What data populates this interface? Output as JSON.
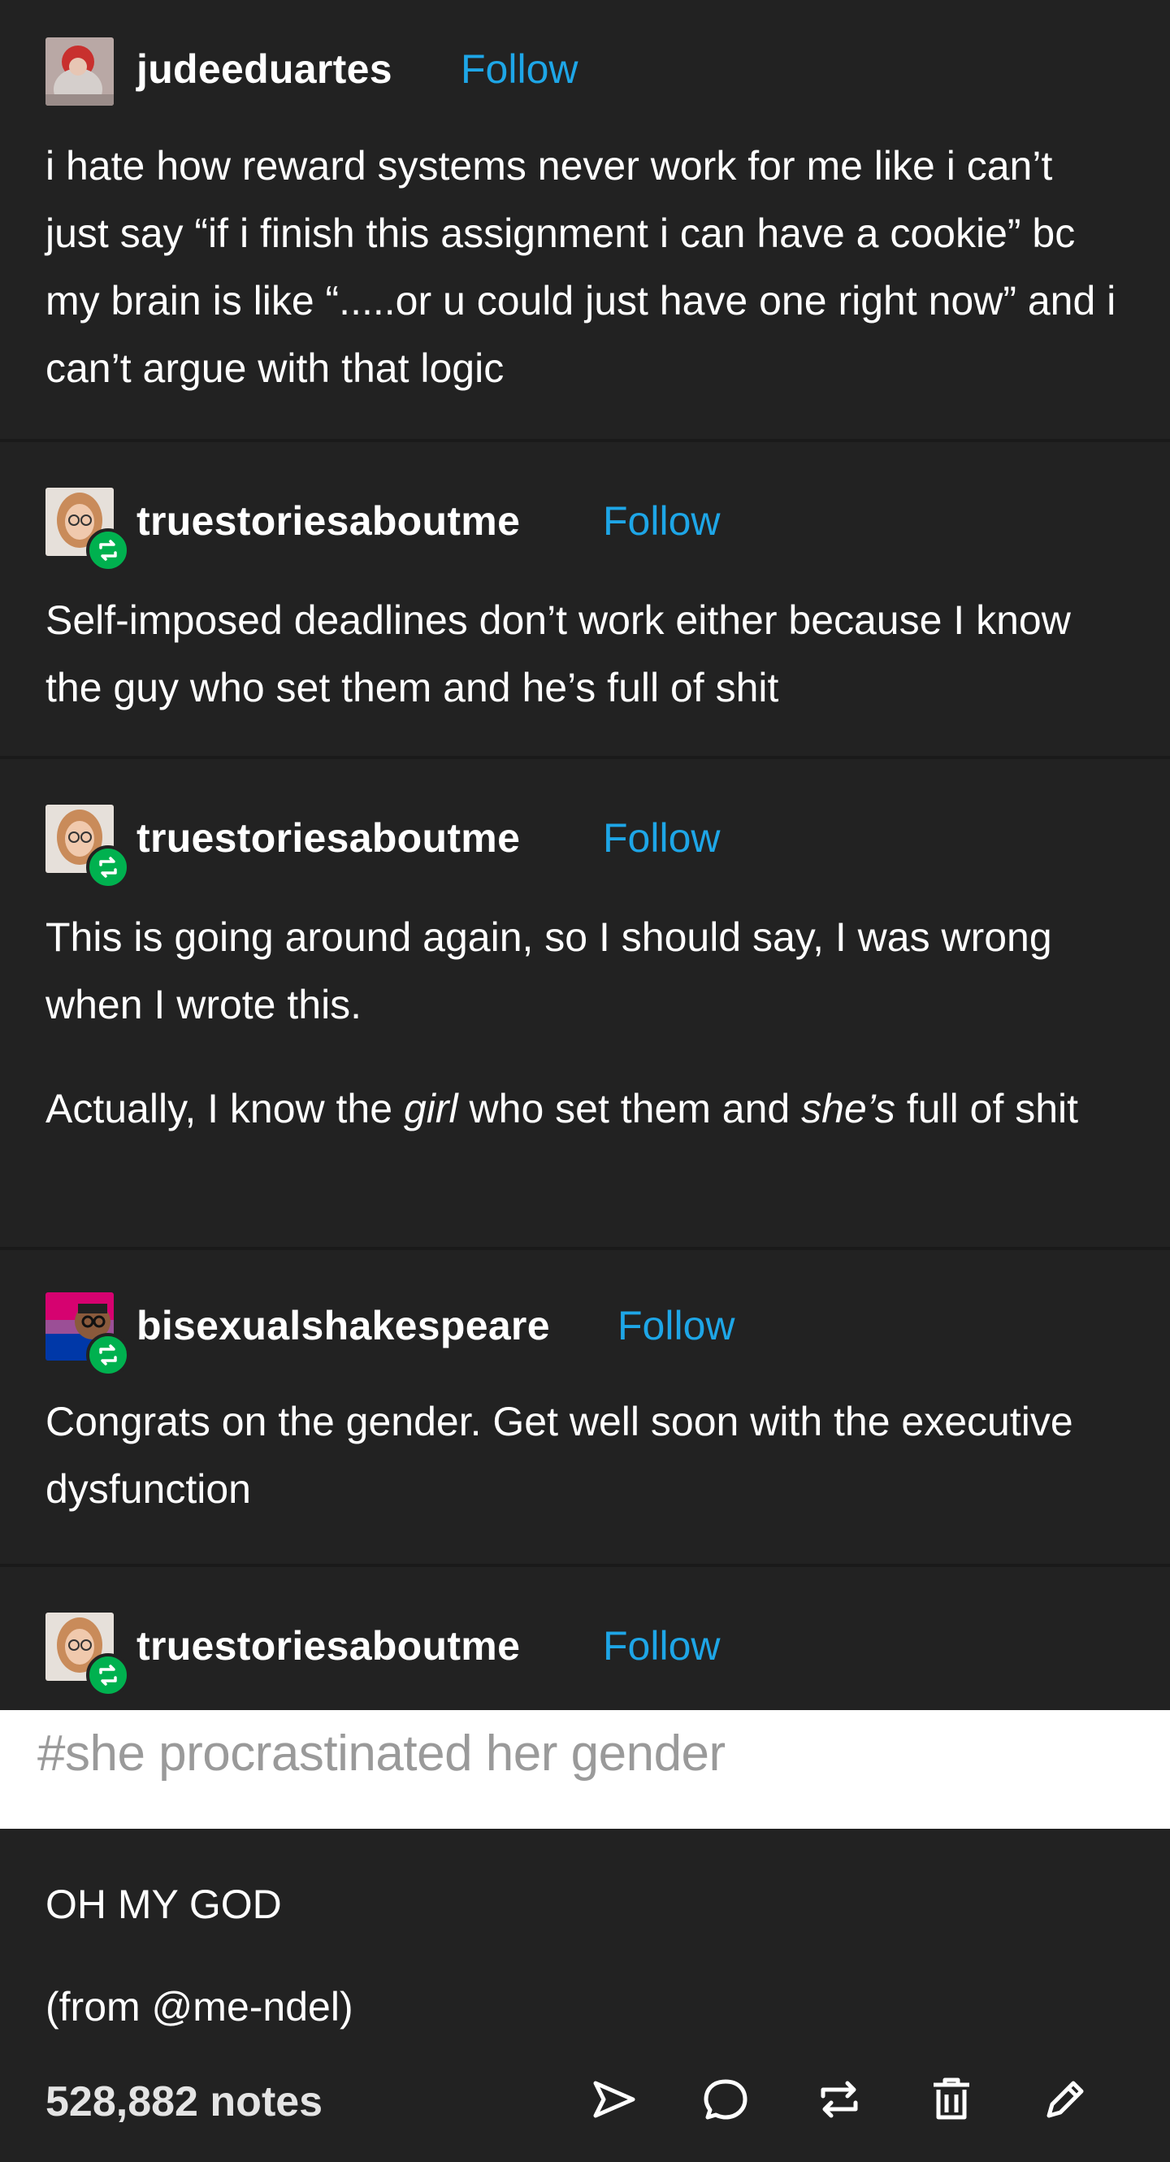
{
  "posts": [
    {
      "username": "judeeduartes",
      "follow_label": "Follow",
      "body": [
        "i hate how reward systems never work for me like i can’t just say “if i finish this assignment i can have a cookie” bc my brain is like “.....or u could just have one right now” and i can’t argue with that logic"
      ]
    },
    {
      "username": "truestoriesaboutme",
      "follow_label": "Follow",
      "body": [
        "Self-imposed deadlines don’t work either because I know the guy who set them and he’s full of shit"
      ]
    },
    {
      "username": "truestoriesaboutme",
      "follow_label": "Follow",
      "body": [
        "This is going around again, so I should say, I was wrong when I wrote this."
      ],
      "body2": {
        "part1": "Actually, I know the ",
        "girl": "girl",
        "part2": " who set them and ",
        "shes": "she’s",
        "part3": " full of shit"
      }
    },
    {
      "username": "bisexualshakespeare",
      "follow_label": "Follow",
      "body": [
        "Congrats on the gender. Get well soon with the executive dysfunction"
      ]
    },
    {
      "username": "truestoriesaboutme",
      "follow_label": "Follow"
    }
  ],
  "tag": "#she procrastinated her gender",
  "footer": {
    "line1": "OH MY GOD",
    "line2": "(from @me-ndel)",
    "notes": "528,882 notes"
  },
  "actions": [
    "send-icon",
    "comment-icon",
    "reblog-icon",
    "trash-icon",
    "edit-icon"
  ],
  "colors": {
    "background": "#222222",
    "follow": "#1ea6e7",
    "reblog_badge": "#00b14f",
    "tag_bar": "#ffffff",
    "tag_text": "#9a9a9a"
  }
}
